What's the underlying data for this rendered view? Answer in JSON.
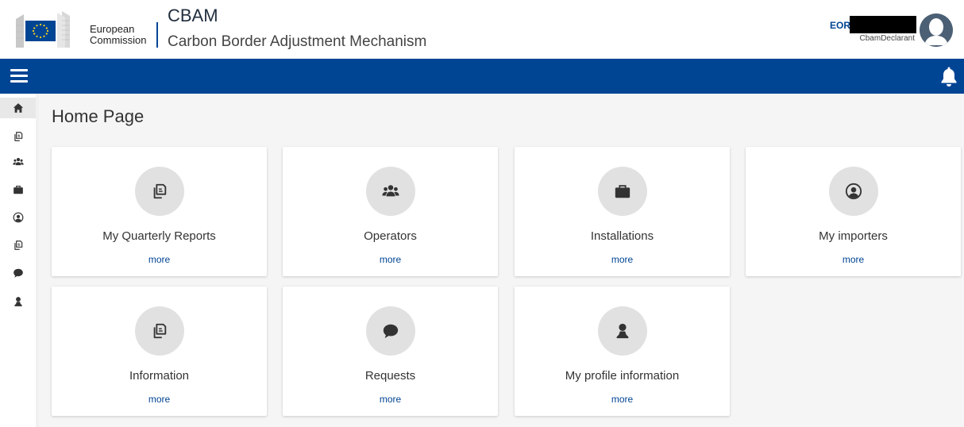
{
  "header": {
    "org_line1": "European",
    "org_line2": "Commission",
    "app_title": "CBAM",
    "app_subtitle": "Carbon Border Adjustment Mechanism",
    "eori_label": "EORI",
    "user_role": "CbamDeclarant"
  },
  "colors": {
    "brand_blue": "#004494",
    "eu_flag_stars": "#ffd617",
    "page_background": "#f5f5f5",
    "icon_circle": "#e1e1e1"
  },
  "sidebar": {
    "items": [
      {
        "icon": "home-icon"
      },
      {
        "icon": "copy-icon"
      },
      {
        "icon": "users-icon"
      },
      {
        "icon": "briefcase-icon"
      },
      {
        "icon": "user-circle-icon"
      },
      {
        "icon": "copy-icon"
      },
      {
        "icon": "comment-icon"
      },
      {
        "icon": "user-icon"
      }
    ]
  },
  "main": {
    "title": "Home Page",
    "cards": [
      {
        "label": "My Quarterly Reports",
        "more": "more",
        "icon": "copy-icon"
      },
      {
        "label": "Operators",
        "more": "more",
        "icon": "users-icon"
      },
      {
        "label": "Installations",
        "more": "more",
        "icon": "briefcase-icon"
      },
      {
        "label": "My importers",
        "more": "more",
        "icon": "user-circle-icon"
      },
      {
        "label": "Information",
        "more": "more",
        "icon": "copy-icon"
      },
      {
        "label": "Requests",
        "more": "more",
        "icon": "comment-icon"
      },
      {
        "label": "My profile information",
        "more": "more",
        "icon": "user-icon"
      }
    ]
  }
}
